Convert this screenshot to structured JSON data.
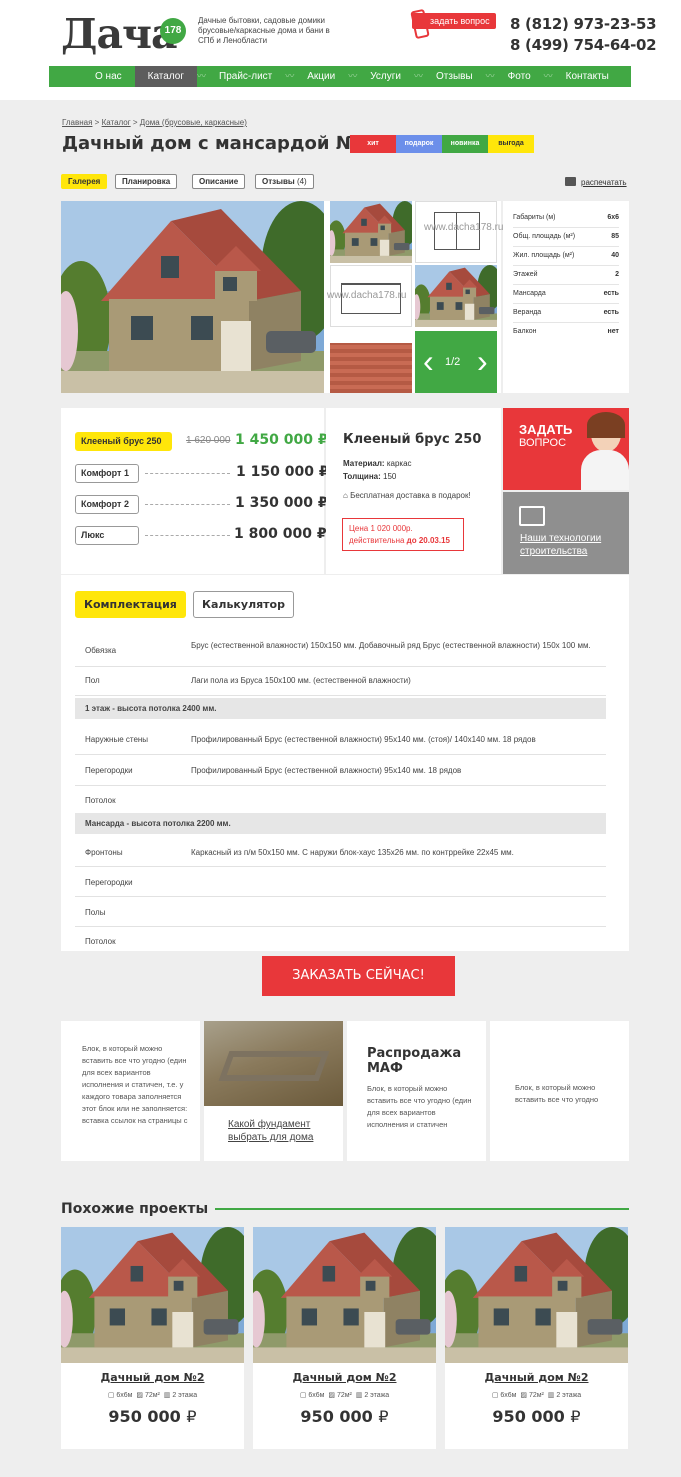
{
  "header": {
    "logo_text": "Дача",
    "logo_badge": "178",
    "tagline": "Дачные бытовки, садовые домики брусовые/каркасные дома и бани в СПб и Ленобласти",
    "ask_button": "задать вопрос",
    "phone1": "8 (812) 973-23-53",
    "phone2": "8 (499) 754-64-02"
  },
  "nav": [
    "О нас",
    "Каталог",
    "Прайс-лист",
    "Акции",
    "Услуги",
    "Отзывы",
    "Фото",
    "Контакты"
  ],
  "breadcrumb": {
    "home": "Главная",
    "catalog": "Каталог",
    "category": "Дома (брусовые, каркасные)"
  },
  "page_title": "Дачный дом с мансардой №16",
  "badges": [
    "хит",
    "подарок",
    "новинка",
    "выгода"
  ],
  "badge_colors": [
    "#e8373a",
    "#6c8fea",
    "#41a844",
    "#ffe60a"
  ],
  "tabs": [
    "Галерея",
    "Планировка",
    "Описание",
    "Отзывы"
  ],
  "reviews_count": "(4)",
  "print_label": "распечатать",
  "gallery": {
    "counter": "1/2",
    "watermark": "www.dacha178.ru"
  },
  "specs": [
    {
      "k": "Габариты (м)",
      "v": "6x6"
    },
    {
      "k": "Общ. площадь (м²)",
      "v": "85"
    },
    {
      "k": "Жил. площадь (м²)",
      "v": "40"
    },
    {
      "k": "Этажей",
      "v": "2"
    },
    {
      "k": "Мансарда",
      "v": "есть"
    },
    {
      "k": "Веранда",
      "v": "есть"
    },
    {
      "k": "Балкон",
      "v": "нет"
    }
  ],
  "options": [
    {
      "name": "Клееный брус 250",
      "old": "1 620 000",
      "price": "1 450 000"
    },
    {
      "name": "Комфорт 1",
      "price": "1 150 000"
    },
    {
      "name": "Комфорт 2",
      "price": "1 350 000"
    },
    {
      "name": "Люкс",
      "price": "1 800 000"
    }
  ],
  "currency": "₽",
  "info": {
    "title": "Клееный брус 250",
    "material_label": "Материал:",
    "material": "каркас",
    "thickness_label": "Толщина:",
    "thickness": "150",
    "delivery": "Бесплатная доставка в подарок!",
    "promo_price": "Цена 1 020 000р.",
    "promo_valid": "действительна",
    "promo_date": "до 20.03.15"
  },
  "ask_block": {
    "line1": "ЗАДАТЬ",
    "line2": "ВОПРОС"
  },
  "tech_block": "Наши технологии строительства",
  "config_tabs": [
    "Комплектация",
    "Калькулятор"
  ],
  "config_rows": [
    {
      "k": "Обвязка",
      "v": "Брус (естественной влажности) 150х150 мм. Добавочный ряд Брус (естественной влажности) 150х 100 мм."
    },
    {
      "k": "Пол",
      "v": "Лаги пола из Бруса 150х100 мм. (естественной влажности)"
    },
    {
      "hd": "1 этаж - высота потолка 2400 мм."
    },
    {
      "k": "Наружные стены",
      "v": "Профилированный Брус (естественной влажности) 95х140 мм. (стоя)/ 140х140 мм. 18 рядов"
    },
    {
      "k": "Перегородки",
      "v": "Профилированный Брус (естественной влажности) 95х140 мм. 18 рядов"
    },
    {
      "k": "Потолок",
      "v": ""
    },
    {
      "hd": "Мансарда - высота потолка 2200 мм."
    },
    {
      "k": "Фронтоны",
      "v": "Каркасный из п/м 50х150 мм. С наружи блок-хаус 135х26 мм. по контррейке 22х45 мм."
    },
    {
      "k": "Перегородки",
      "v": ""
    },
    {
      "k": "Полы",
      "v": ""
    },
    {
      "k": "Потолок",
      "v": ""
    }
  ],
  "order_button": "ЗАКАЗАТЬ СЕЙЧАС!",
  "cards": {
    "c1": "Блок, в который можно вставить все что угодно (един для всех вариантов исполнения и статичен, т.е. у каждого товара заполняется этот блок или не заполняется: вставка ссылок на страницы с",
    "c2": "Какой фундамент выбрать для дома",
    "c3_title": "Распродажа МАФ",
    "c3_text": "Блок, в который можно вставить все что угодно (един для всех вариантов исполнения и статичен",
    "c4": "Блок, в который можно вставить все что угодно"
  },
  "similar": {
    "title": "Похожие проекты",
    "items": [
      {
        "name": "Дачный дом №2",
        "size": "6x6м",
        "area": "72м²",
        "floors": "2 этажа",
        "price": "950 000"
      },
      {
        "name": "Дачный дом №2",
        "size": "6x6м",
        "area": "72м²",
        "floors": "2 этажа",
        "price": "950 000"
      },
      {
        "name": "Дачный дом №2",
        "size": "6x6м",
        "area": "72м²",
        "floors": "2 этажа",
        "price": "950 000"
      }
    ]
  }
}
